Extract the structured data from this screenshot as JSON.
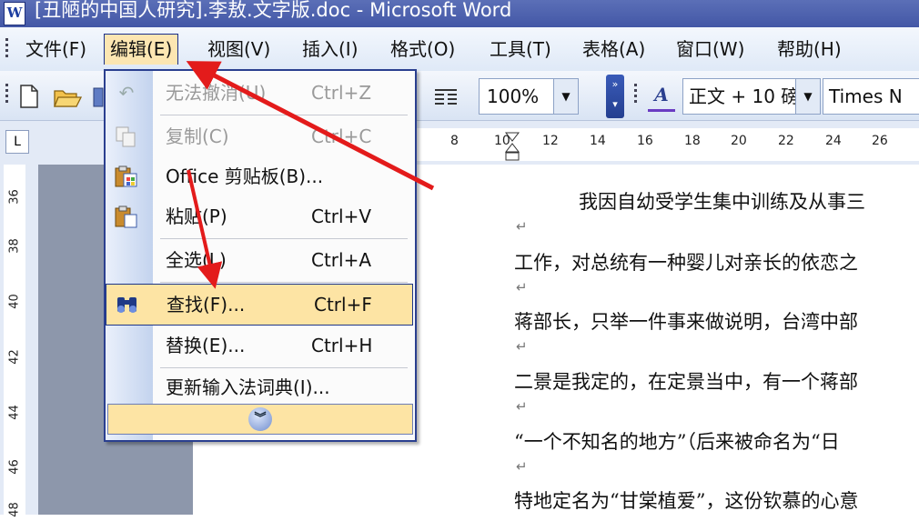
{
  "window": {
    "title": "[丑陋的中国人研究].李敖.文字版.doc - Microsoft Word",
    "doc_icon": "W"
  },
  "menubar": {
    "items": [
      {
        "label": "文件(F)"
      },
      {
        "label": "编辑(E)"
      },
      {
        "label": "视图(V)"
      },
      {
        "label": "插入(I)"
      },
      {
        "label": "格式(O)"
      },
      {
        "label": "工具(T)"
      },
      {
        "label": "表格(A)"
      },
      {
        "label": "窗口(W)"
      },
      {
        "label": "帮助(H)"
      }
    ],
    "active_index": 1
  },
  "toolbar": {
    "zoom": "100%",
    "style": "正文 + 10 磅",
    "font": "Times N",
    "style_icon": "A"
  },
  "ruler": {
    "corner": "L",
    "marks": [
      "8",
      "10",
      "12",
      "14",
      "16",
      "18",
      "20",
      "22",
      "24",
      "26"
    ],
    "vertical_marks": [
      "36",
      "38",
      "40",
      "42",
      "44",
      "46",
      "48"
    ]
  },
  "edit_menu": {
    "items": [
      {
        "label": "无法撤消(U)",
        "shortcut": "Ctrl+Z",
        "icon": "undo-icon",
        "disabled": true
      },
      {
        "label": "复制(C)",
        "shortcut": "Ctrl+C",
        "icon": "copy-icon",
        "disabled": true
      },
      {
        "label": "Office 剪贴板(B)...",
        "shortcut": "",
        "icon": "clipboard-icon",
        "disabled": false
      },
      {
        "label": "粘贴(P)",
        "shortcut": "Ctrl+V",
        "icon": "paste-icon",
        "disabled": false
      },
      {
        "label": "全选(L)",
        "shortcut": "Ctrl+A",
        "icon": "",
        "disabled": false
      },
      {
        "label": "查找(F)...",
        "shortcut": "Ctrl+F",
        "icon": "binoculars-icon",
        "disabled": false,
        "highlighted": true
      },
      {
        "label": "替换(E)...",
        "shortcut": "Ctrl+H",
        "icon": "",
        "disabled": false
      },
      {
        "label": "更新输入法词典(I)...",
        "shortcut": "",
        "icon": "",
        "disabled": false
      }
    ],
    "expand_icon": "double-chevron-down-icon"
  },
  "document": {
    "lines": [
      "我因自幼受学生集中训练及从事三",
      "工作，对总统有一种婴儿对亲长的依恋之",
      "蒋部长，只举一件事来做说明，台湾中部",
      "二景是我定的，在定景当中，有一个蒋部",
      "“一个不知名的地方”（后来被命名为“日",
      "特地定名为“甘棠植爱”，这份钦慕的心意"
    ],
    "para_mark": "↵"
  },
  "colors": {
    "accent": "#2a3f8f",
    "highlight": "#fde4a4",
    "annotation_arrow": "#e31b1b"
  }
}
